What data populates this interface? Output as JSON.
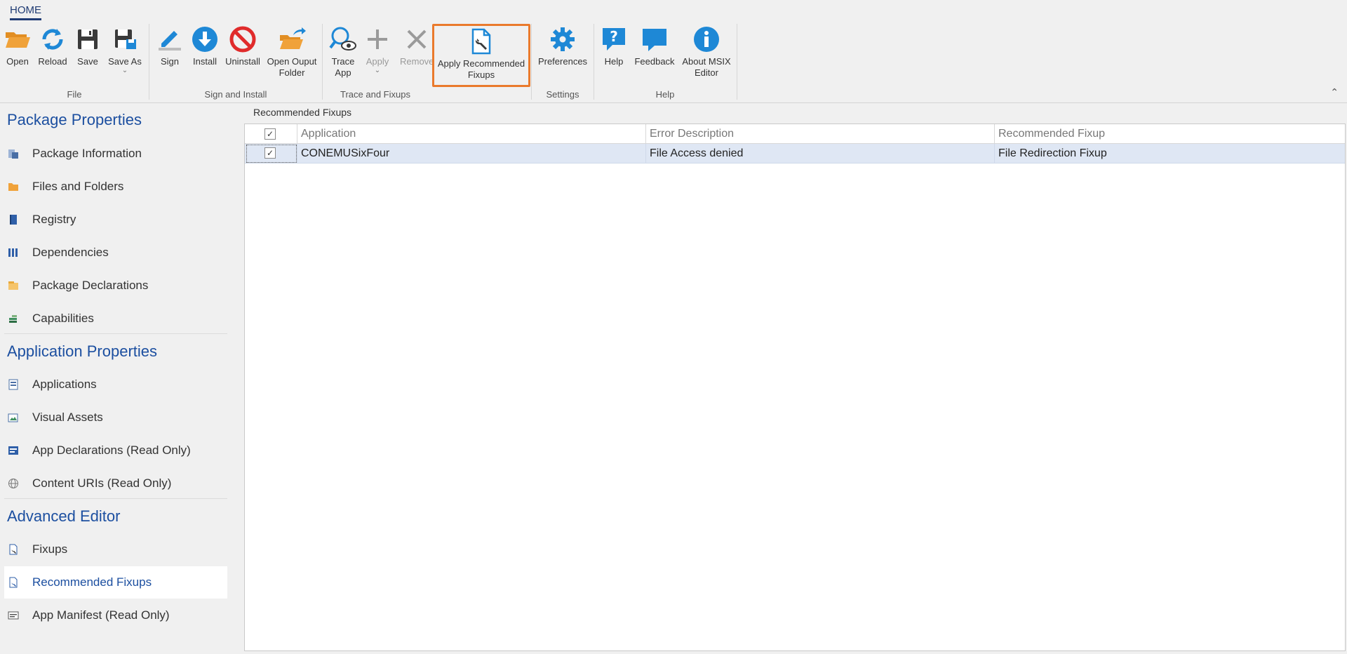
{
  "tabs": {
    "home": "HOME"
  },
  "ribbon": {
    "groups": {
      "file": "File",
      "sign_install": "Sign and Install",
      "trace_fixups": "Trace and Fixups",
      "settings": "Settings",
      "help": "Help"
    },
    "buttons": {
      "open": "Open",
      "reload": "Reload",
      "save": "Save",
      "save_as": "Save As",
      "sign": "Sign",
      "install": "Install",
      "uninstall": "Uninstall",
      "open_output_l1": "Open Ouput",
      "open_output_l2": "Folder",
      "trace_l1": "Trace",
      "trace_l2": "App",
      "apply": "Apply",
      "remove": "Remove",
      "apply_rec_l1": "Apply Recommended",
      "apply_rec_l2": "Fixups",
      "preferences": "Preferences",
      "help": "Help",
      "feedback": "Feedback",
      "about_l1": "About MSIX",
      "about_l2": "Editor"
    },
    "collapse_glyph": "⌃"
  },
  "sidebar": {
    "package_properties": {
      "title": "Package Properties",
      "items": [
        "Package Information",
        "Files and Folders",
        "Registry",
        "Dependencies",
        "Package Declarations",
        "Capabilities"
      ]
    },
    "application_properties": {
      "title": "Application Properties",
      "items": [
        "Applications",
        "Visual Assets",
        "App Declarations (Read Only)",
        "Content URIs (Read Only)"
      ]
    },
    "advanced_editor": {
      "title": "Advanced Editor",
      "items": [
        "Fixups",
        "Recommended Fixups",
        "App Manifest (Read Only)"
      ]
    }
  },
  "main": {
    "panel_title": "Recommended Fixups",
    "columns": [
      "Application",
      "Error Description",
      "Recommended Fixup"
    ],
    "rows": [
      {
        "checked": "✓",
        "application": "CONEMUSixFour",
        "error": "File Access denied",
        "fixup": "File Redirection Fixup"
      }
    ],
    "header_check": "✓"
  },
  "colors": {
    "accent": "#1c4fa0",
    "highlight": "#ea7a2c",
    "icon_blue": "#1e88d6",
    "icon_orange": "#f0a23a",
    "icon_red": "#e02b2b"
  }
}
